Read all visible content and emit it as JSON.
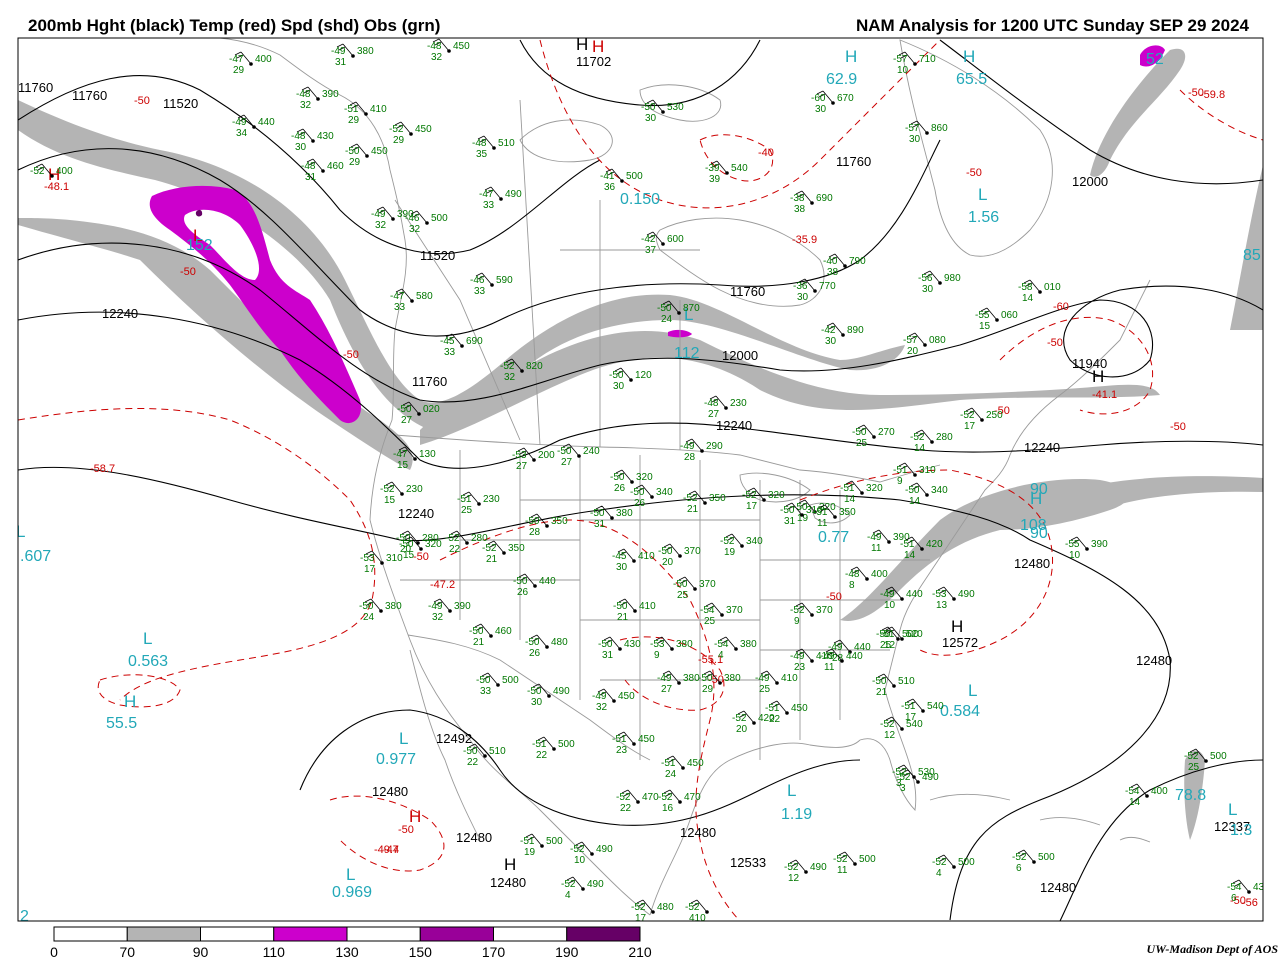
{
  "header": {
    "title_left": "200mb Hght (black) Temp (red) Spd (shd) Obs (grn)",
    "title_right": "NAM Analysis for 1200 UTC Sunday  SEP 29 2024"
  },
  "legend": {
    "labels": [
      "0",
      "70",
      "90",
      "110",
      "130",
      "150",
      "170",
      "190",
      "210"
    ],
    "fill_colors": [
      "#ffffff",
      "#b4b4b4",
      "#ffffff",
      "#cc00cc",
      "#ffffff",
      "#990099",
      "#ffffff",
      "#660066"
    ]
  },
  "credit": "UW-Madison   Dept of AOS",
  "colors": {
    "height": "#000000",
    "temp": "#cc0000",
    "obs": "#007700",
    "speed_label": "#22a8b8",
    "speed_gray": "#b4b4b4",
    "speed_magenta": "#cc00cc",
    "map_lines": "#9a9a9a"
  },
  "height_labels": [
    "11760",
    "11520",
    "11760",
    "11520",
    "12240",
    "11702",
    "11760",
    "12000",
    "11760",
    "12000",
    "11940",
    "12240",
    "12240",
    "11760",
    "12240",
    "12480",
    "12572",
    "12480",
    "12492",
    "12480",
    "12480",
    "12480",
    "12533",
    "12480",
    "12480",
    "12337"
  ],
  "temp_labels": [
    "-50",
    "-48.1",
    "-50",
    "-50",
    "-40",
    "-50",
    "-35.9",
    "-50",
    "-59.8",
    "-60",
    "-50",
    "-41.1",
    "-50",
    "-50",
    "-58.7",
    "-50",
    "-47.2",
    "-50",
    "-55.1",
    "-50",
    "-47",
    "-50",
    "-49.4",
    "-50",
    "-56"
  ],
  "highs_lows": [
    "H",
    "L",
    "H",
    "H",
    "H",
    "L",
    "H",
    "L",
    "H",
    "L",
    "L",
    "L",
    "H",
    "H",
    "L",
    "H",
    "L",
    "L",
    "H",
    "L",
    "H"
  ],
  "speed_values": [
    "152",
    "62.9",
    "65.5",
    "1.56",
    "0.150",
    "112",
    "90",
    "108",
    "90",
    "0.77",
    ".607",
    "0.563",
    "55.5",
    "0.977",
    "0.584",
    "1.19",
    "0.969",
    "78.8",
    "1.3",
    "85",
    "52",
    "2"
  ],
  "observations": [
    {
      "t": "-47",
      "d": "29",
      "h": "400"
    },
    {
      "t": "-49",
      "d": "31",
      "h": "380"
    },
    {
      "t": "-48",
      "d": "32",
      "h": "450"
    },
    {
      "t": "-48",
      "d": "32",
      "h": "390"
    },
    {
      "t": "-51",
      "d": "29",
      "h": "410"
    },
    {
      "t": "-49",
      "d": "34",
      "h": "440"
    },
    {
      "t": "-52",
      "d": "29",
      "h": "450"
    },
    {
      "t": "-48",
      "d": "30",
      "h": "430"
    },
    {
      "t": "-50",
      "d": "29",
      "h": "450"
    },
    {
      "t": "-48",
      "d": "31",
      "h": "460"
    },
    {
      "t": "-48",
      "d": "35",
      "h": "510"
    },
    {
      "t": "-50",
      "d": "30",
      "h": "530"
    },
    {
      "t": "-41",
      "d": "36",
      "h": "500"
    },
    {
      "t": "-39",
      "d": "39",
      "h": "540"
    },
    {
      "t": "-47",
      "d": "33",
      "h": "490"
    },
    {
      "t": "-49",
      "d": "32",
      "h": "390"
    },
    {
      "t": "-46",
      "d": "32",
      "h": "500"
    },
    {
      "t": "-42",
      "d": "37",
      "h": "600"
    },
    {
      "t": "-38",
      "d": "38",
      "h": "690"
    },
    {
      "t": "-40",
      "d": "38",
      "h": "790"
    },
    {
      "t": "-46",
      "d": "33",
      "h": "590"
    },
    {
      "t": "-47",
      "d": "33",
      "h": "580"
    },
    {
      "t": "-45",
      "d": "33",
      "h": "690"
    },
    {
      "t": "-52",
      "d": "32",
      "h": "820"
    },
    {
      "t": "-56",
      "d": "30",
      "h": "980"
    },
    {
      "t": "-57",
      "d": "30",
      "h": "860"
    },
    {
      "t": "-57",
      "d": "10",
      "h": "710"
    },
    {
      "t": "-60",
      "d": "30",
      "h": "670"
    },
    {
      "t": "-58",
      "d": "14",
      "h": "010"
    },
    {
      "t": "-55",
      "d": "15",
      "h": "060"
    },
    {
      "t": "-57",
      "d": "20",
      "h": "080"
    },
    {
      "t": "-42",
      "d": "30",
      "h": "890"
    },
    {
      "t": "-36",
      "d": "30",
      "h": "770"
    },
    {
      "t": "-50",
      "d": "24",
      "h": "870"
    },
    {
      "t": "-50",
      "d": "30",
      "h": "120"
    },
    {
      "t": "-48",
      "d": "27",
      "h": "230"
    },
    {
      "t": "-52",
      "d": "17",
      "h": "250"
    },
    {
      "t": "-50",
      "d": "25",
      "h": "270"
    },
    {
      "t": "-52",
      "d": "14",
      "h": "280"
    },
    {
      "t": "-49",
      "d": "28",
      "h": "290"
    },
    {
      "t": "-53",
      "d": "27",
      "h": "200"
    },
    {
      "t": "-50",
      "d": "27",
      "h": "240"
    },
    {
      "t": "-50",
      "d": "27",
      "h": "020"
    },
    {
      "t": "-47",
      "d": "15",
      "h": "130"
    },
    {
      "t": "-52",
      "d": "15",
      "h": "230"
    },
    {
      "t": "-51",
      "d": "25",
      "h": "230"
    },
    {
      "t": "-50",
      "d": "26",
      "h": "320"
    },
    {
      "t": "-50",
      "d": "26",
      "h": "340"
    },
    {
      "t": "-52",
      "d": "21",
      "h": "350"
    },
    {
      "t": "-52",
      "d": "17",
      "h": "320"
    },
    {
      "t": "-50",
      "d": "19",
      "h": "320"
    },
    {
      "t": "-51",
      "d": "9",
      "h": "310"
    },
    {
      "t": "-51",
      "d": "14",
      "h": "320"
    },
    {
      "t": "-50",
      "d": "14",
      "h": "340"
    },
    {
      "t": "-50",
      "d": "28",
      "h": "350"
    },
    {
      "t": "-50",
      "d": "31",
      "h": "380"
    },
    {
      "t": "-52",
      "d": "22",
      "h": "280"
    },
    {
      "t": "-52",
      "d": "21",
      "h": "350"
    },
    {
      "t": "-50",
      "d": "20",
      "h": "280"
    },
    {
      "t": "-53",
      "d": "17",
      "h": "310"
    },
    {
      "t": "-50",
      "d": "15",
      "h": "320"
    },
    {
      "t": "-52",
      "d": "19",
      "h": "340"
    },
    {
      "t": "-50",
      "d": "31",
      "h": "310"
    },
    {
      "t": "-51",
      "d": "11",
      "h": "350"
    },
    {
      "t": "-49",
      "d": "11",
      "h": "390"
    },
    {
      "t": "-51",
      "d": "14",
      "h": "420"
    },
    {
      "t": "-45",
      "d": "30",
      "h": "410"
    },
    {
      "t": "-50",
      "d": "20",
      "h": "370"
    },
    {
      "t": "-50",
      "d": "25",
      "h": "370"
    },
    {
      "t": "-48",
      "d": "8",
      "h": "400"
    },
    {
      "t": "-49",
      "d": "10",
      "h": "440"
    },
    {
      "t": "-53",
      "d": "13",
      "h": "490"
    },
    {
      "t": "-50",
      "d": "26",
      "h": "440"
    },
    {
      "t": "-50",
      "d": "24",
      "h": "380"
    },
    {
      "t": "-49",
      "d": "32",
      "h": "390"
    },
    {
      "t": "-50",
      "d": "21",
      "h": "410"
    },
    {
      "t": "-54",
      "d": "25",
      "h": "370"
    },
    {
      "t": "-52",
      "d": "9",
      "h": "370"
    },
    {
      "t": "-50",
      "d": "25",
      "h": "500"
    },
    {
      "t": "-49",
      "d": "28",
      "h": "440"
    },
    {
      "t": "-50",
      "d": "21",
      "h": "460"
    },
    {
      "t": "-50",
      "d": "26",
      "h": "480"
    },
    {
      "t": "-50",
      "d": "31",
      "h": "430"
    },
    {
      "t": "-53",
      "d": "9",
      "h": "380"
    },
    {
      "t": "-54",
      "d": "4",
      "h": "380"
    },
    {
      "t": "-49",
      "d": "23",
      "h": "410"
    },
    {
      "t": "-49",
      "d": "11",
      "h": "440"
    },
    {
      "t": "-50",
      "d": "33",
      "h": "500"
    },
    {
      "t": "-50",
      "d": "30",
      "h": "490"
    },
    {
      "t": "-49",
      "d": "32",
      "h": "450"
    },
    {
      "t": "-49",
      "d": "27",
      "h": "380"
    },
    {
      "t": "-50",
      "d": "29",
      "h": "380"
    },
    {
      "t": "-49",
      "d": "25",
      "h": "410"
    },
    {
      "t": "-50",
      "d": "21",
      "h": "510"
    },
    {
      "t": "-51",
      "d": "17",
      "h": "540"
    },
    {
      "t": "-51",
      "d": "22",
      "h": "450"
    },
    {
      "t": "-52",
      "d": "20",
      "h": "420"
    },
    {
      "t": "-50",
      "d": "22",
      "h": "510"
    },
    {
      "t": "-51",
      "d": "22",
      "h": "500"
    },
    {
      "t": "-51",
      "d": "23",
      "h": "450"
    },
    {
      "t": "-51",
      "d": "24",
      "h": "450"
    },
    {
      "t": "-52",
      "d": "22",
      "h": "470"
    },
    {
      "t": "-52",
      "d": "16",
      "h": "470"
    },
    {
      "t": "-51",
      "d": "19",
      "h": "500"
    },
    {
      "t": "-52",
      "d": "10",
      "h": "490"
    },
    {
      "t": "-52",
      "d": "3",
      "h": "490"
    },
    {
      "t": "-52",
      "d": "4",
      "h": "490"
    },
    {
      "t": "-52",
      "d": "12",
      "h": "490"
    },
    {
      "t": "-52",
      "d": "11",
      "h": "500"
    },
    {
      "t": "-52",
      "d": "4",
      "h": "500"
    },
    {
      "t": "-52",
      "d": "6",
      "h": "500"
    },
    {
      "t": "-52",
      "d": "3",
      "h": "530"
    },
    {
      "t": "-52",
      "d": "12",
      "h": "540"
    },
    {
      "t": "-51",
      "d": "12",
      "h": "520"
    },
    {
      "t": "-52",
      "d": "25",
      "h": "500"
    },
    {
      "t": "-54",
      "d": "14",
      "h": "400"
    },
    {
      "t": "-54",
      "d": "6",
      "h": "430"
    },
    {
      "t": "-55",
      "d": "10",
      "h": "390"
    },
    {
      "t": "-52",
      "d": "17",
      "h": "480"
    },
    {
      "t": "-52",
      "d": "410",
      "h": ""
    },
    {
      "t": "-52",
      "d": "",
      "h": "400"
    }
  ]
}
